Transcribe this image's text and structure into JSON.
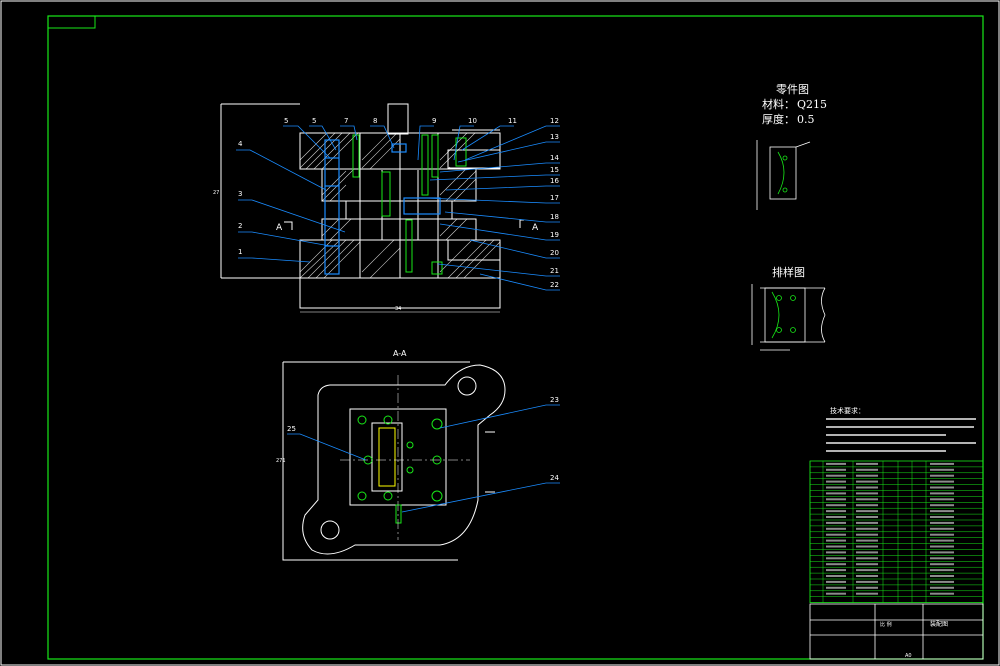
{
  "corner_tag": "",
  "section_mark": "A",
  "section_title": "A-A",
  "callouts_left": [
    "5",
    "5",
    "7",
    "8",
    "4",
    "3",
    "2",
    "1"
  ],
  "callouts_right": [
    "9",
    "10",
    "11",
    "12",
    "13",
    "14",
    "15",
    "16",
    "17",
    "18",
    "19",
    "20",
    "21",
    "22"
  ],
  "plan_callouts": [
    "23",
    "24",
    "25"
  ],
  "dimension_front_width": "34",
  "dimension_front_height": "27",
  "dimension_plan_height": "271",
  "part_drawing": {
    "title": "零件图",
    "material_label": "材料：",
    "material": "Q215",
    "thickness_label": "厚度：",
    "thickness": "0.5"
  },
  "layout_drawing": {
    "title": "排样图"
  },
  "tech_requirements_title": "技术要求：",
  "title_block": {
    "right_label": "装配图",
    "scale": "比 例",
    "sheet": "A0"
  }
}
